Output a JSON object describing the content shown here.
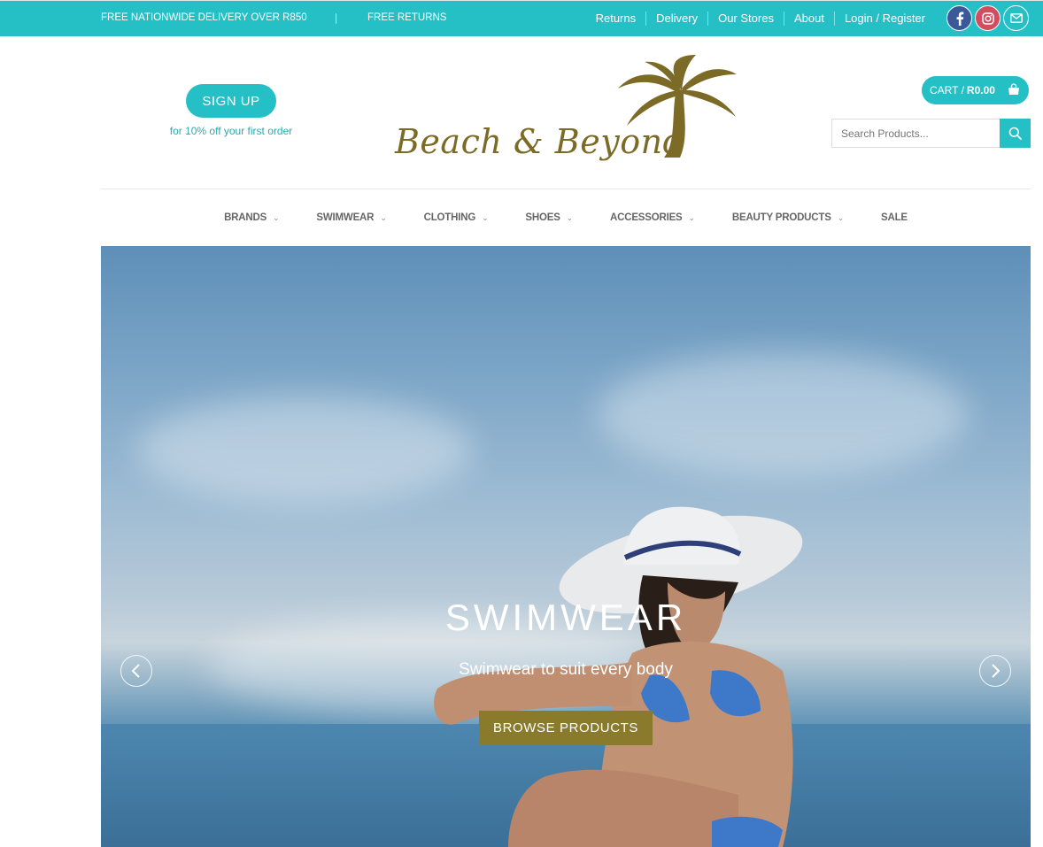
{
  "topbar": {
    "delivery_msg": "FREE NATIONWIDE DELIVERY OVER R850",
    "separator": "|",
    "returns_msg": "FREE RETURNS",
    "links": [
      "Returns",
      "Delivery",
      "Our Stores",
      "About",
      "Login / Register"
    ],
    "social": [
      "facebook-icon",
      "instagram-icon",
      "email-icon"
    ]
  },
  "header": {
    "signup_label": "SIGN UP",
    "signup_sub": "for 10% off your first order",
    "logo_text": "Beach & Beyond",
    "cart_label": "CART /",
    "cart_amount": "R0.00",
    "search_placeholder": "Search Products..."
  },
  "nav": {
    "items": [
      {
        "label": "BRANDS",
        "has_dropdown": true
      },
      {
        "label": "SWIMWEAR",
        "has_dropdown": true
      },
      {
        "label": "CLOTHING",
        "has_dropdown": true
      },
      {
        "label": "SHOES",
        "has_dropdown": true
      },
      {
        "label": "ACCESSORIES",
        "has_dropdown": true
      },
      {
        "label": "BEAUTY PRODUCTS",
        "has_dropdown": true
      },
      {
        "label": "SALE",
        "has_dropdown": false
      }
    ]
  },
  "hero": {
    "title": "SWIMWEAR",
    "subtitle": "Swimwear to suit every body",
    "button": "BROWSE PRODUCTS"
  },
  "colors": {
    "accent": "#25c0c6",
    "gold": "#8a7a2c",
    "logo_brown": "#7c6b26"
  }
}
